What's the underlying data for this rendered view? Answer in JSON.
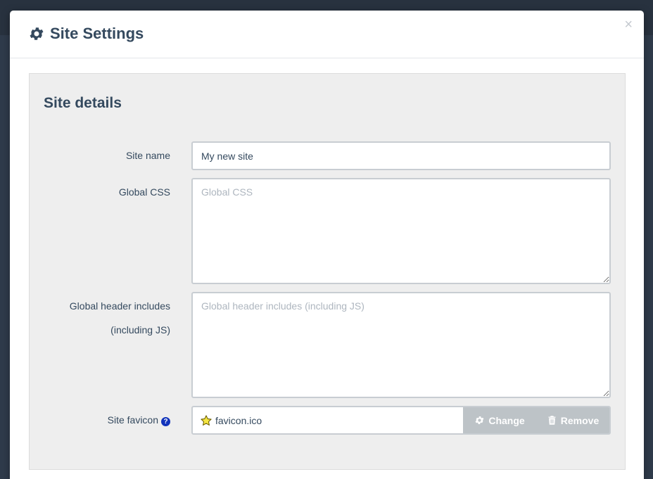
{
  "modal": {
    "title": "Site Settings",
    "close": "×"
  },
  "panel": {
    "title": "Site details",
    "fields": {
      "site_name": {
        "label": "Site name",
        "value": "My new site"
      },
      "global_css": {
        "label": "Global CSS",
        "placeholder": "Global CSS"
      },
      "global_header": {
        "label_line1": "Global header includes",
        "label_line2": "(including JS)",
        "placeholder": "Global header includes (including JS)"
      },
      "favicon": {
        "label": "Site favicon",
        "help": "?",
        "file": "favicon.ico",
        "change_label": "Change",
        "remove_label": "Remove"
      }
    }
  },
  "colors": {
    "heading": "#34495e",
    "button_bg": "#bdc3c7",
    "help_icon": "#1133bb",
    "star_fill": "#f5e642"
  },
  "icons": [
    "gear-icon",
    "close-icon",
    "help-icon",
    "star-icon",
    "trash-icon"
  ]
}
